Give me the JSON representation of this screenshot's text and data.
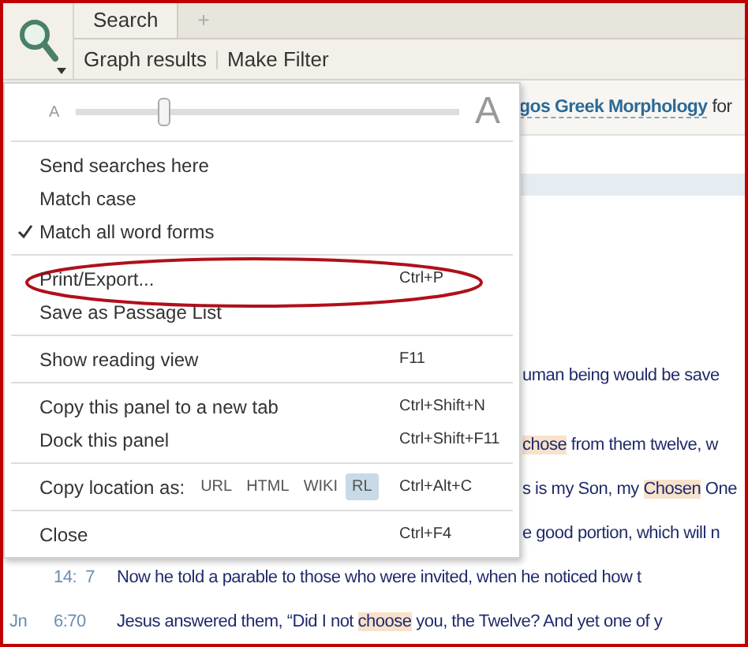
{
  "tabs": [
    {
      "label": "Search",
      "selected": true
    },
    {
      "label": "+",
      "selected": false
    }
  ],
  "toolbar": [
    "Graph results",
    "Make Filter"
  ],
  "query": {
    "link": "gos Greek Morphology",
    "after": "for"
  },
  "results": [
    {
      "segments": [
        {
          "text": "uman being would be save",
          "highlighted": false
        }
      ]
    },
    {
      "segments": [
        {
          "text": "chose",
          "highlighted": true
        },
        {
          "text": " from them twelve, w",
          "highlighted": false
        }
      ]
    },
    {
      "segments": [
        {
          "text": "s is my Son, my ",
          "highlighted": false
        },
        {
          "text": "Chosen",
          "highlighted": true
        },
        {
          "text": " One",
          "highlighted": false
        }
      ]
    },
    {
      "segments": [
        {
          "text": "e good portion, which will n",
          "highlighted": false
        }
      ]
    },
    {
      "ref": "14:  7",
      "segments": [
        {
          "text": "Now he told a parable to those who were invited, when he noticed how t",
          "highlighted": false
        }
      ]
    },
    {
      "book": "Jn",
      "ref": "6:70",
      "segments": [
        {
          "text": "Jesus answered them, “Did I not ",
          "highlighted": false
        },
        {
          "text": "choose",
          "highlighted": true
        },
        {
          "text": " you, the Twelve? And yet one of y",
          "highlighted": false
        }
      ]
    }
  ],
  "menu": {
    "font_slider": {
      "small_label": "A",
      "large_label": "A",
      "level": 0.23
    },
    "groups": [
      [
        {
          "kind": "toggle",
          "label": "Send searches here",
          "checked": false,
          "circled": false
        },
        {
          "kind": "toggle",
          "label": "Match case",
          "checked": false,
          "circled": false
        },
        {
          "kind": "toggle",
          "label": "Match all word forms",
          "checked": true,
          "circled": false
        }
      ],
      [
        {
          "kind": "command",
          "label": "Print/Export...",
          "shortcut": "Ctrl+P",
          "circled": true
        },
        {
          "kind": "command",
          "label": "Save as Passage List",
          "circled": false
        }
      ],
      [
        {
          "kind": "command",
          "label": "Show reading view",
          "shortcut": "F11",
          "circled": false
        }
      ],
      [
        {
          "kind": "command",
          "label": "Copy this panel to a new tab",
          "shortcut": "Ctrl+Shift+N",
          "circled": false
        },
        {
          "kind": "command",
          "label": "Dock this panel",
          "shortcut": "Ctrl+Shift+F11",
          "circled": false
        }
      ],
      [
        {
          "kind": "formats",
          "label": "Copy location as:",
          "shortcut": "Ctrl+Alt+C",
          "circled": false,
          "formats": [
            {
              "label": "URL",
              "selected": false
            },
            {
              "label": "HTML",
              "selected": false
            },
            {
              "label": "WIKI",
              "selected": false
            },
            {
              "label": "RL",
              "selected": true
            }
          ]
        }
      ],
      [
        {
          "kind": "command",
          "label": "Close",
          "shortcut": "Ctrl+F4",
          "circled": false
        }
      ]
    ]
  }
}
